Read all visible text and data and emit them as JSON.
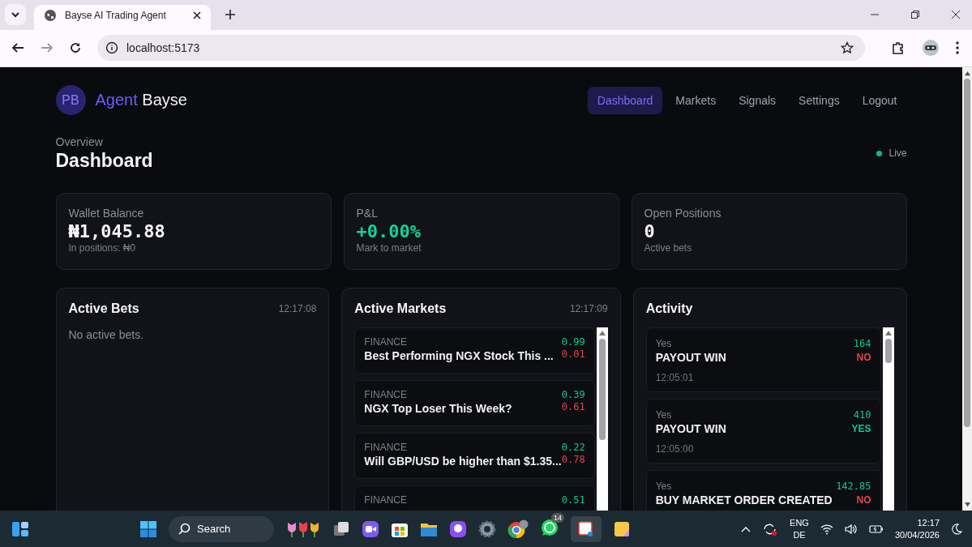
{
  "browser": {
    "tab_title": "Bayse AI Trading Agent",
    "url": "localhost:5173"
  },
  "brand": {
    "initials": "PB",
    "accent": "Agent",
    "name": "Bayse"
  },
  "nav": [
    {
      "label": "Dashboard",
      "selected": true
    },
    {
      "label": "Markets",
      "selected": false
    },
    {
      "label": "Signals",
      "selected": false
    },
    {
      "label": "Settings",
      "selected": false
    },
    {
      "label": "Logout",
      "selected": false
    }
  ],
  "header": {
    "eyebrow": "Overview",
    "title": "Dashboard",
    "status": "Live"
  },
  "stats": [
    {
      "label": "Wallet Balance",
      "value": "₦1,045.88",
      "note": "In positions: ₦0",
      "positive": false
    },
    {
      "label": "P&L",
      "value": "+0.00%",
      "note": "Mark to market",
      "positive": true
    },
    {
      "label": "Open Positions",
      "value": "0",
      "note": "Active bets",
      "positive": false
    }
  ],
  "active_bets": {
    "title": "Active Bets",
    "time": "12:17:08",
    "empty": "No active bets."
  },
  "active_markets": {
    "title": "Active Markets",
    "time": "12:17:09",
    "markets": [
      {
        "category": "FINANCE",
        "title": "Best Performing NGX Stock This ...",
        "yes": "0.99",
        "no": "0.01"
      },
      {
        "category": "FINANCE",
        "title": "NGX Top Loser This Week?",
        "yes": "0.39",
        "no": "0.61"
      },
      {
        "category": "FINANCE",
        "title": "Will GBP/USD be higher than $1.35...",
        "yes": "0.22",
        "no": "0.78"
      },
      {
        "category": "FINANCE",
        "yes": "0.51"
      }
    ]
  },
  "activity": {
    "title": "Activity",
    "items": [
      {
        "outcome": "Yes",
        "event": "PAYOUT WIN",
        "amount": "164",
        "side": "NO",
        "positive": false,
        "time": "12:05:01"
      },
      {
        "outcome": "Yes",
        "event": "PAYOUT WIN",
        "amount": "410",
        "side": "YES",
        "positive": true,
        "time": "12:05:00"
      },
      {
        "outcome": "Yes",
        "event": "BUY MARKET ORDER CREATED",
        "amount": "142.85",
        "side": "NO",
        "positive": false
      }
    ]
  },
  "taskbar": {
    "search": "Search",
    "badge": "14",
    "lang": "ENG",
    "layout": "DE",
    "time": "12:17",
    "date": "30/04/2026"
  }
}
